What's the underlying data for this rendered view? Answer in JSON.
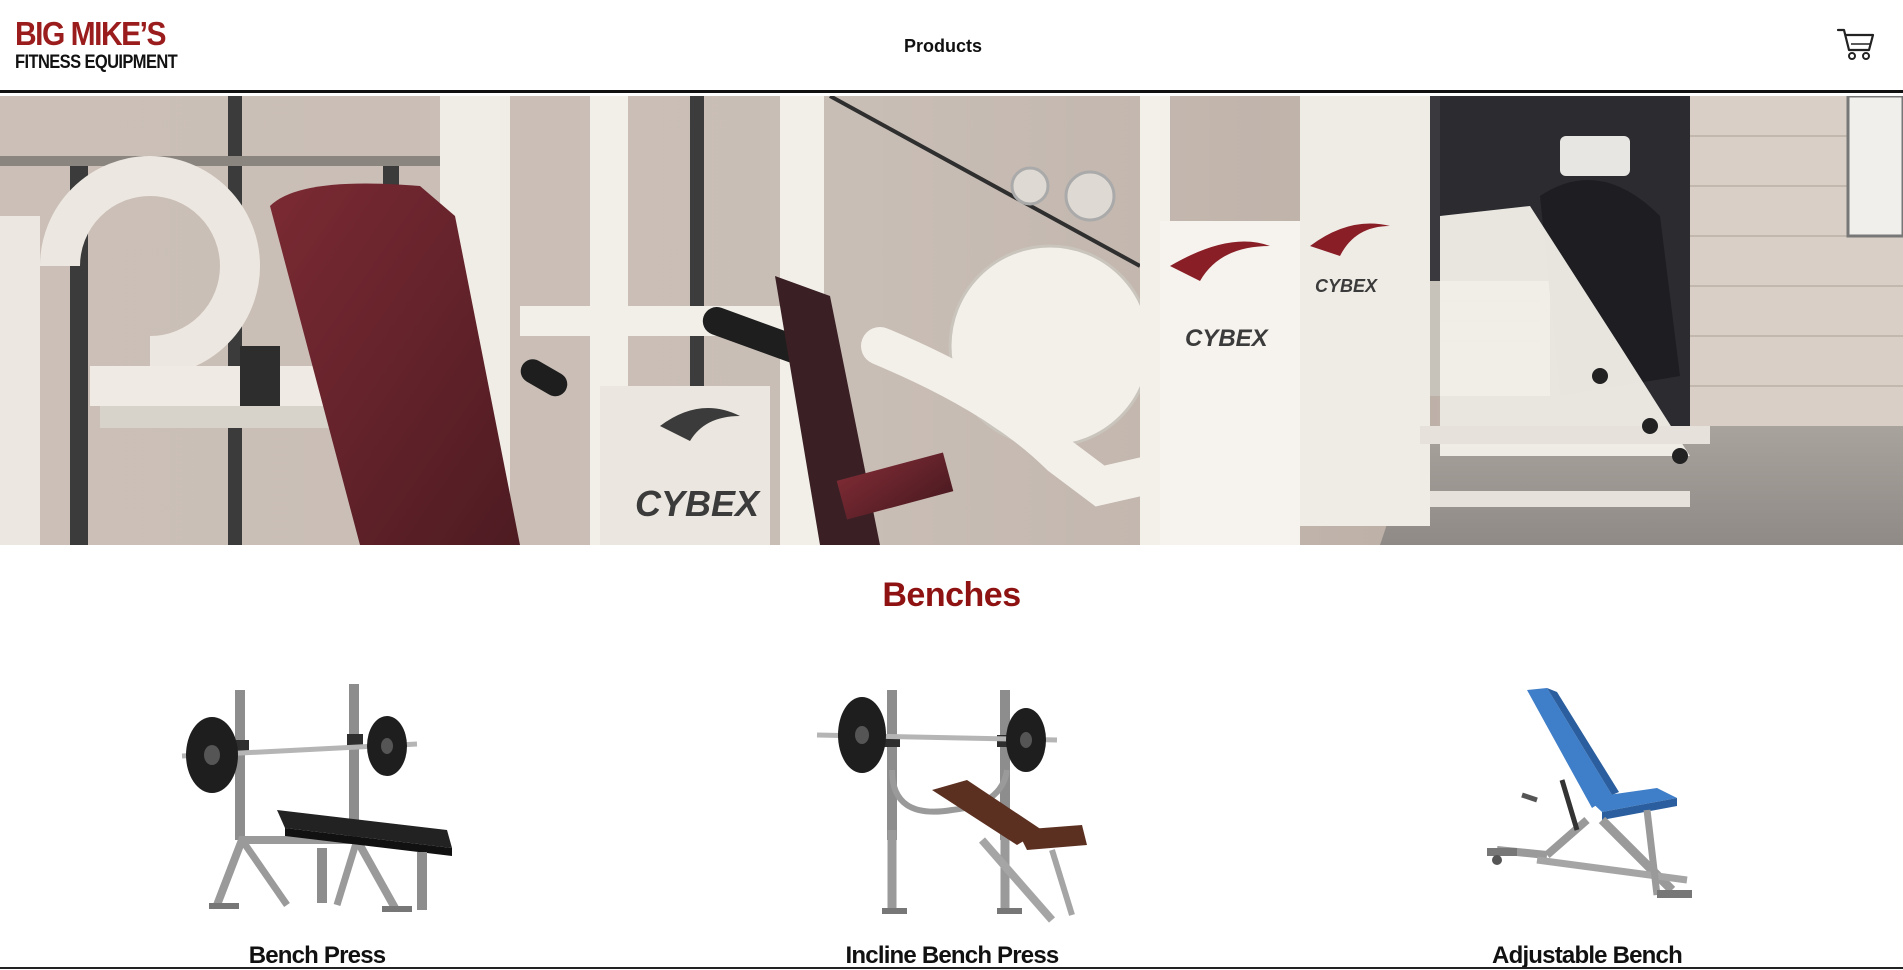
{
  "header": {
    "logo_line1": "BIG MIKE’S",
    "logo_line2": "FITNESS EQUIPMENT",
    "nav_products": "Products",
    "cart_icon": "shopping-cart-icon"
  },
  "hero": {
    "brand_mark": "CYBEX"
  },
  "section": {
    "title": "Benches"
  },
  "products": [
    {
      "name": "Bench Press",
      "icon": "flat-bench-press-image"
    },
    {
      "name": "Incline Bench Press",
      "icon": "incline-bench-press-image"
    },
    {
      "name": "Adjustable Bench",
      "icon": "adjustable-bench-image"
    }
  ],
  "colors": {
    "brand_red": "#9b1c1c",
    "title_red": "#8e1212",
    "text_dark": "#111111",
    "bench_blue": "#3f7ec8",
    "bench_brown": "#6b3a2a"
  }
}
